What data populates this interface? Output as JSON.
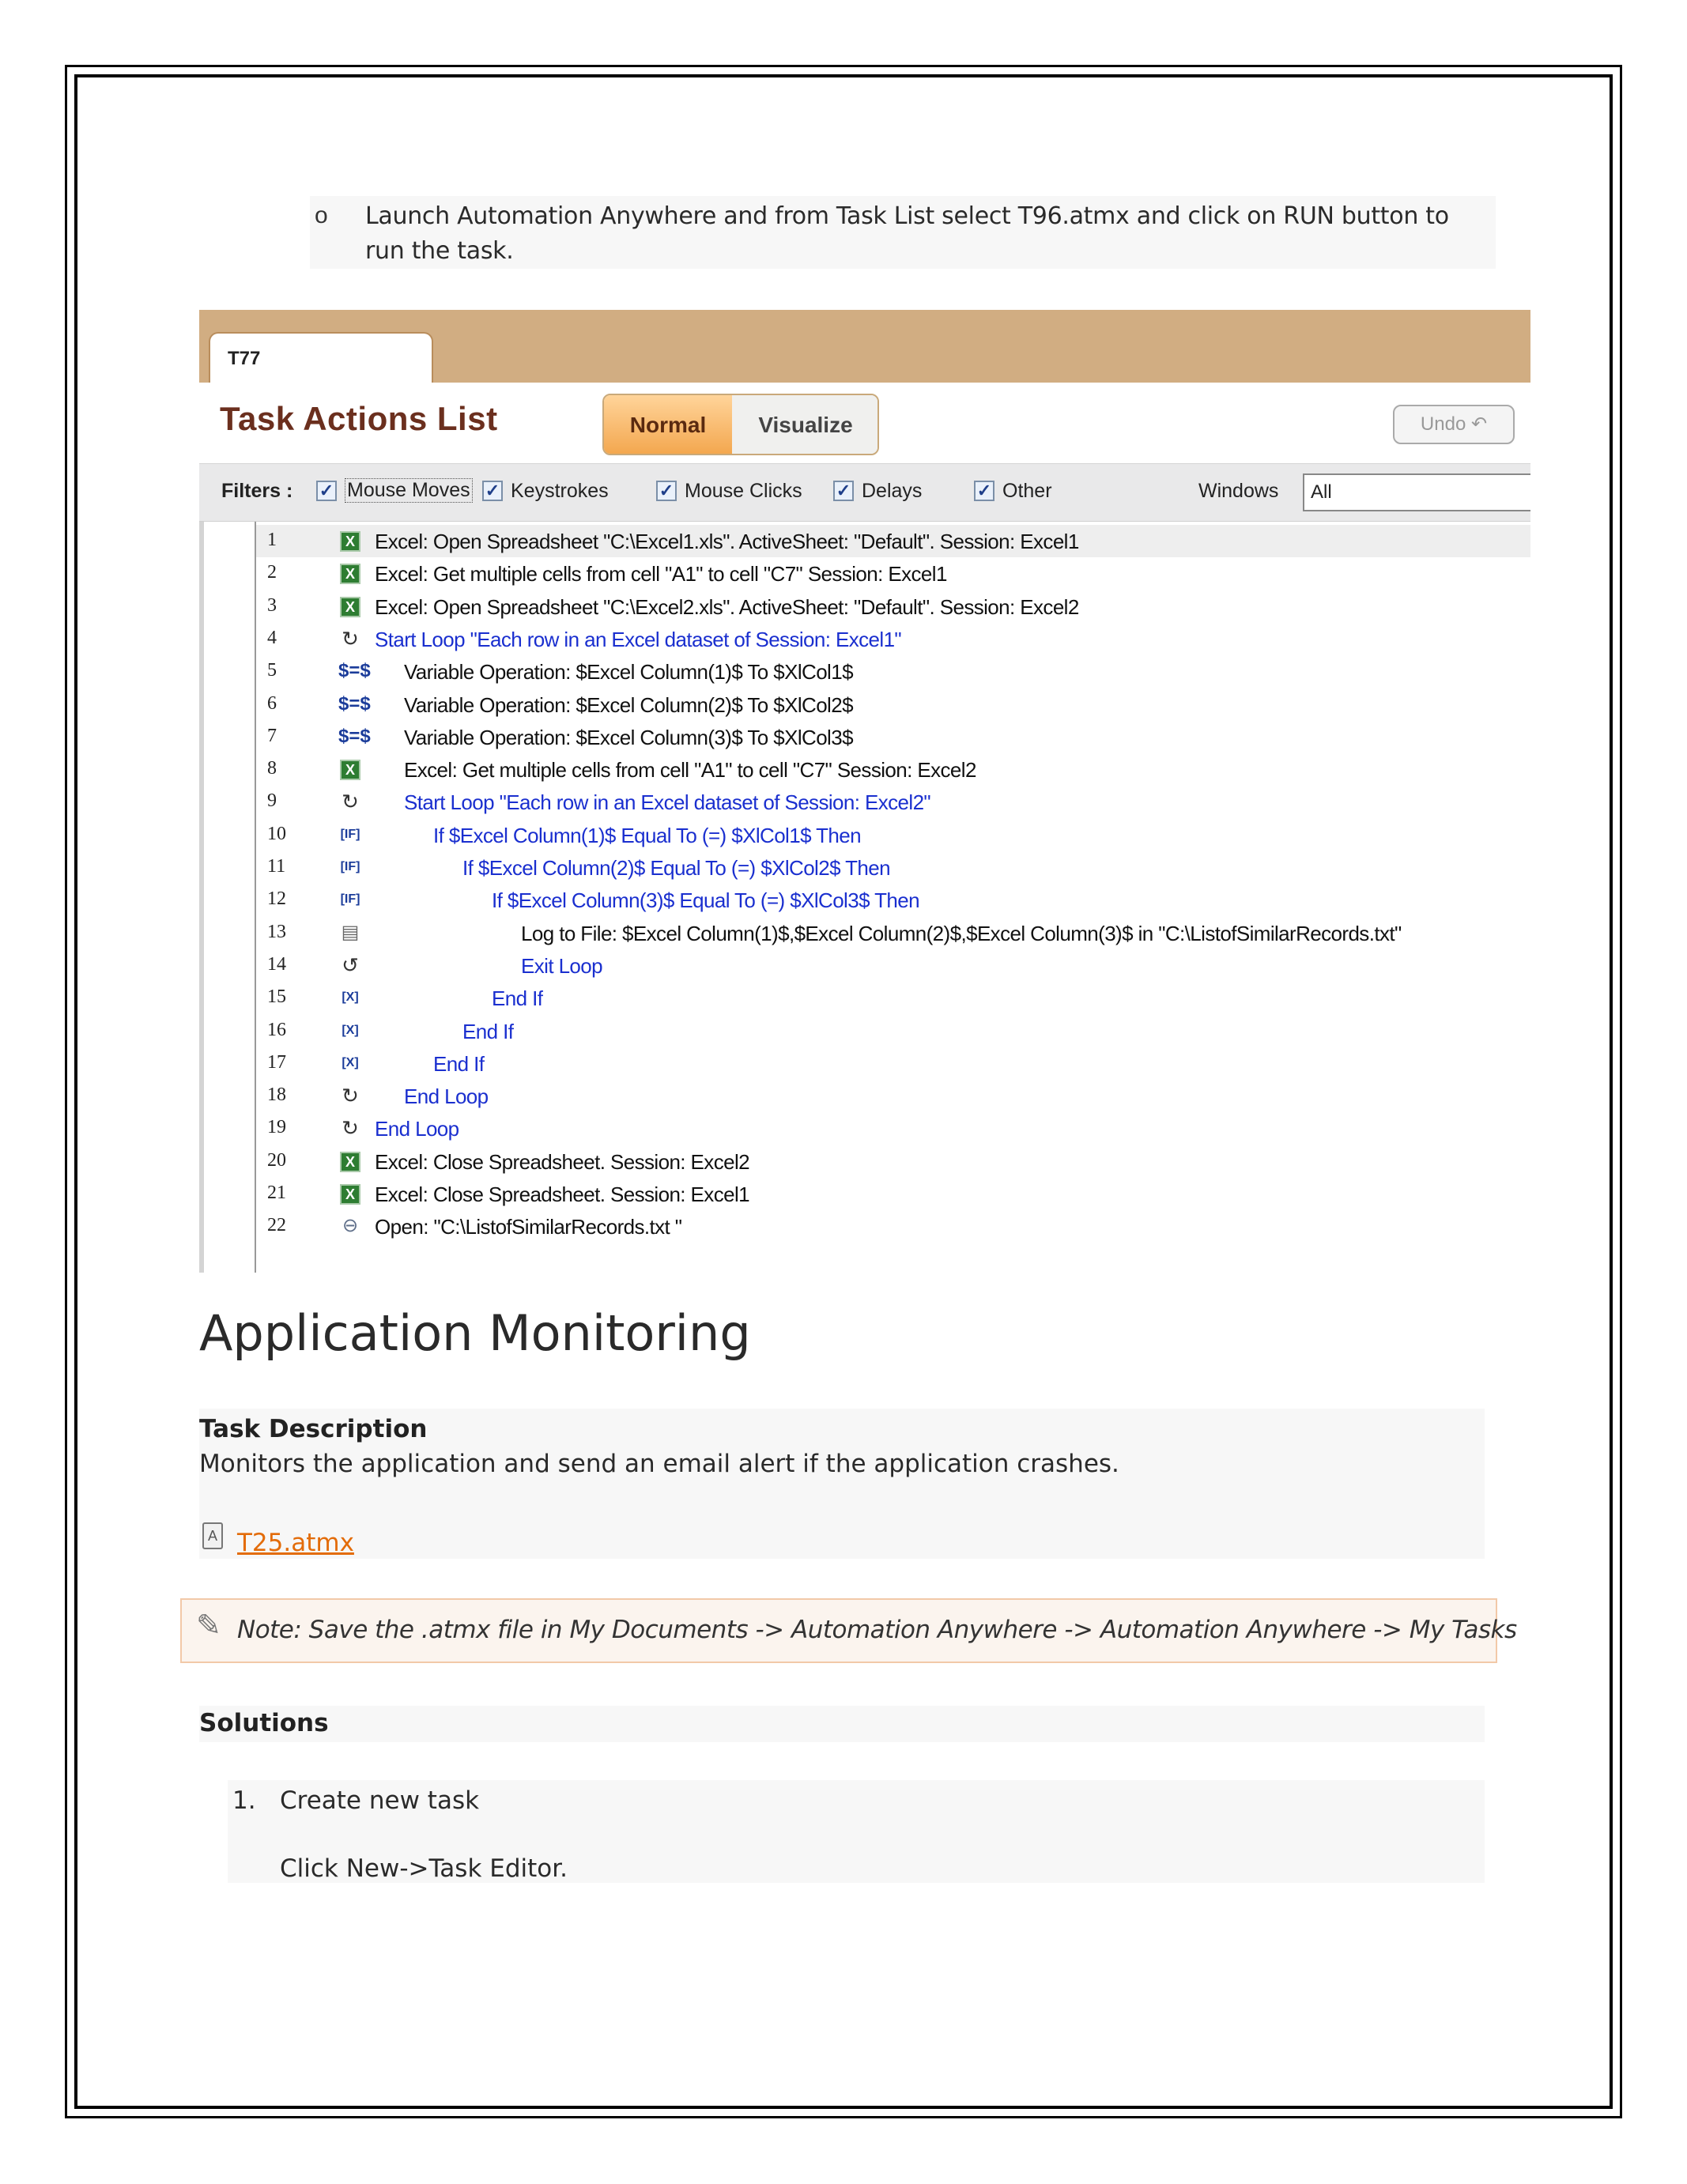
{
  "launch": {
    "bullet": "o",
    "text": "Launch Automation Anywhere and from Task List select T96.atmx and click on RUN button to run the task."
  },
  "screenshot": {
    "tab_label": "T77",
    "title": "Task Actions List",
    "mode_normal": "Normal",
    "mode_visualize": "Visualize",
    "undo_label": "Undo",
    "filters": {
      "label": "Filters :",
      "items": [
        "Mouse Moves",
        "Keystrokes",
        "Mouse Clicks",
        "Delays",
        "Other"
      ],
      "windows_label": "Windows",
      "windows_value": "All"
    },
    "actions": [
      {
        "n": "1",
        "icon": "excel-icon",
        "indent": 0,
        "color": "black",
        "text": "Excel: Open Spreadsheet \"C:\\Excel1.xls\". ActiveSheet: \"Default\". Session: Excel1"
      },
      {
        "n": "2",
        "icon": "excel-icon",
        "indent": 0,
        "color": "black",
        "text": "Excel: Get multiple cells from cell \"A1\" to cell \"C7\" Session: Excel1"
      },
      {
        "n": "3",
        "icon": "excel-icon",
        "indent": 0,
        "color": "black",
        "text": "Excel: Open Spreadsheet \"C:\\Excel2.xls\". ActiveSheet: \"Default\". Session: Excel2"
      },
      {
        "n": "4",
        "icon": "loop-icon",
        "indent": 0,
        "color": "blue",
        "text": "Start Loop \"Each row in an Excel dataset of Session: Excel1\""
      },
      {
        "n": "5",
        "icon": "variable-icon",
        "indent": 1,
        "color": "black",
        "text": "Variable Operation: $Excel Column(1)$ To $XlCol1$"
      },
      {
        "n": "6",
        "icon": "variable-icon",
        "indent": 1,
        "color": "black",
        "text": "Variable Operation: $Excel Column(2)$ To $XlCol2$"
      },
      {
        "n": "7",
        "icon": "variable-icon",
        "indent": 1,
        "color": "black",
        "text": "Variable Operation: $Excel Column(3)$ To $XlCol3$"
      },
      {
        "n": "8",
        "icon": "excel-icon",
        "indent": 1,
        "color": "black",
        "text": "Excel: Get multiple cells from cell \"A1\" to cell \"C7\" Session: Excel2"
      },
      {
        "n": "9",
        "icon": "loop-icon",
        "indent": 1,
        "color": "blue",
        "text": "Start Loop \"Each row in an Excel dataset of Session: Excel2\""
      },
      {
        "n": "10",
        "icon": "if-icon",
        "indent": 2,
        "color": "blue",
        "text": "If $Excel Column(1)$ Equal To (=) $XlCol1$ Then"
      },
      {
        "n": "11",
        "icon": "if-icon",
        "indent": 3,
        "color": "blue",
        "text": "If $Excel Column(2)$ Equal To (=) $XlCol2$ Then"
      },
      {
        "n": "12",
        "icon": "if-icon",
        "indent": 4,
        "color": "blue",
        "text": "If $Excel Column(3)$ Equal To (=) $XlCol3$ Then"
      },
      {
        "n": "13",
        "icon": "log-file-icon",
        "indent": 5,
        "color": "black",
        "text": "Log to File: $Excel Column(1)$,$Excel Column(2)$,$Excel Column(3)$ in \"C:\\ListofSimilarRecords.txt\""
      },
      {
        "n": "14",
        "icon": "exit-loop-icon",
        "indent": 5,
        "color": "blue",
        "text": "Exit Loop"
      },
      {
        "n": "15",
        "icon": "end-if-icon",
        "indent": 4,
        "color": "blue",
        "text": "End If"
      },
      {
        "n": "16",
        "icon": "end-if-icon",
        "indent": 3,
        "color": "blue",
        "text": "End If"
      },
      {
        "n": "17",
        "icon": "end-if-icon",
        "indent": 2,
        "color": "blue",
        "text": "End If"
      },
      {
        "n": "18",
        "icon": "end-loop-icon",
        "indent": 1,
        "color": "blue",
        "text": "End Loop"
      },
      {
        "n": "19",
        "icon": "end-loop-icon",
        "indent": 0,
        "color": "blue",
        "text": "End Loop"
      },
      {
        "n": "20",
        "icon": "excel-icon",
        "indent": 0,
        "color": "black",
        "text": "Excel: Close Spreadsheet. Session: Excel2"
      },
      {
        "n": "21",
        "icon": "excel-icon",
        "indent": 0,
        "color": "black",
        "text": "Excel: Close Spreadsheet. Session: Excel1"
      },
      {
        "n": "22",
        "icon": "open-file-icon",
        "indent": 0,
        "color": "black",
        "text": "Open: \"C:\\ListofSimilarRecords.txt \""
      }
    ]
  },
  "section": {
    "heading": "Application Monitoring",
    "task_description_title": "Task Description",
    "task_description_body": "Monitors the application and send an email alert if the application crashes.",
    "attachment": "T25.atmx",
    "note": "Note: Save the .atmx file in My Documents -> Automation Anywhere -> Automation Anywhere -> My Tasks",
    "solutions_title": "Solutions",
    "step1_num": "1.",
    "step1_text": "Create new task",
    "step1_sub": "Click New->Task Editor."
  }
}
